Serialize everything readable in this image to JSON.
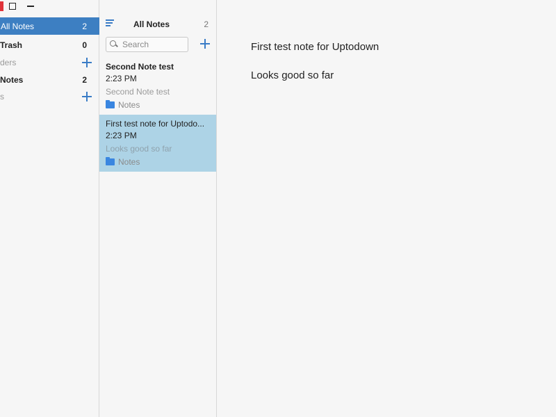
{
  "sidebar": {
    "items": [
      {
        "label": "All Notes",
        "count": "2"
      },
      {
        "label": "Trash",
        "count": "0"
      },
      {
        "label": "ders"
      },
      {
        "label": "Notes",
        "count": "2"
      },
      {
        "label": "s"
      }
    ]
  },
  "list": {
    "title": "All Notes",
    "count": "2",
    "search_placeholder": "Search",
    "notes": [
      {
        "title": "Second Note test",
        "time": "2:23 PM",
        "preview": "Second Note test",
        "folder": "Notes"
      },
      {
        "title": "First test note for Uptodo...",
        "time": "2:23 PM",
        "preview": "Looks good so far",
        "folder": "Notes"
      }
    ]
  },
  "editor": {
    "lines": [
      "First test note for Uptodown",
      "Looks good so far"
    ]
  },
  "colors": {
    "accent": "#3d7fc2",
    "selected_note": "#add3e6",
    "plus_icon": "#3a7cc6",
    "folder_icon": "#3a86e0",
    "close_button": "#e0333a"
  }
}
